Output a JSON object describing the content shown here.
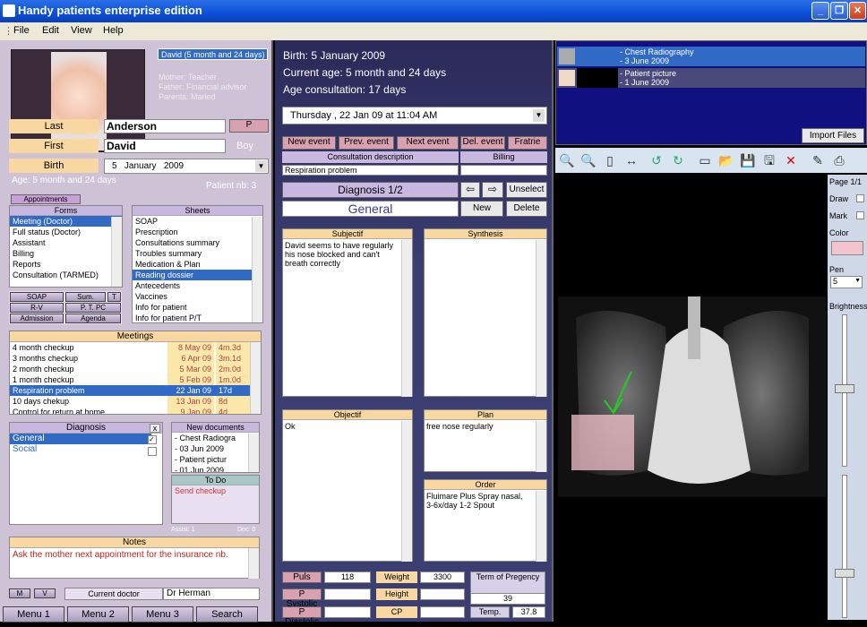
{
  "app": {
    "title": "Handy patients enterprise edition"
  },
  "menu": [
    "File",
    "Edit",
    "View",
    "Help"
  ],
  "patient": {
    "header": "David  (5 month and 24 days)",
    "mother": "Mother: Teacher",
    "father": "Father: Financial advisor",
    "parents": "Parents: Maried",
    "last_label": "Last",
    "last": "Anderson",
    "p_btn": "P",
    "first_label": "First",
    "first": "David",
    "sex": "Boy",
    "birth_label": "Birth",
    "birth_day": "5",
    "birth_month": "January",
    "birth_year": "2009",
    "age": "Age: 5 month and 24 days",
    "patient_nb": "Patient nb: 3"
  },
  "appointments_btn": "Appointments",
  "forms": {
    "title": "Forms",
    "items": [
      "Meeting (Doctor)",
      "Full status (Doctor)",
      "Assistant",
      "Billing",
      "Reports",
      "Consultation (TARMED)"
    ]
  },
  "sheets": {
    "title": "Sheets",
    "items": [
      "SOAP",
      "Prescription",
      "Consultations summary",
      "Troubles summary",
      "Medication & Plan",
      "Reading dossier",
      "Antecedents",
      "Vaccines",
      "Info for patient",
      "Info for patient P/T"
    ]
  },
  "small_btns": {
    "soap": "SOAP",
    "sum": "Sum.",
    "t": "T",
    "rv": "R-V",
    "ptpc": "P. T. PC",
    "admission": "Admission",
    "agenda": "Agenda"
  },
  "meetings": {
    "title": "Meetings",
    "rows": [
      [
        "4 month checkup",
        "8 May 09",
        "4m.3d"
      ],
      [
        "3 months checkup",
        "6 Apr 09",
        "3m.1d"
      ],
      [
        "2 month checkup",
        "5 Mar 09",
        "2m.0d"
      ],
      [
        "1 month checkup",
        "5 Feb 09",
        "1m.0d"
      ],
      [
        "Respiration problem",
        "22 Jan 09",
        "17d"
      ],
      [
        "10 days chekup",
        "13 Jan 09",
        "8d"
      ],
      [
        "Control for return at home",
        "9 Jan 09",
        "4d"
      ]
    ]
  },
  "diagnosis": {
    "title": "Diagnosis",
    "close": "x",
    "items": [
      "General",
      "Social"
    ]
  },
  "new_documents": {
    "title": "New documents",
    "items": [
      "- Chest Radiogra",
      "- 03 Jun 2009",
      "- Patient pictur",
      "- 01 Jun 2009"
    ]
  },
  "todo": {
    "title": "To Do",
    "item": "Send checkup",
    "assist": "Assist: 1",
    "doc": "Doc: 0"
  },
  "notes": {
    "title": "Notes",
    "text": "Ask the mother next appointment for the insurance nb."
  },
  "doctor": {
    "m": "M",
    "v": "V",
    "label": "Current doctor",
    "name": "Dr Herman"
  },
  "bottom_menu": [
    "Menu 1",
    "Menu 2",
    "Menu 3",
    "Search"
  ],
  "consult": {
    "birth": "Birth: 5 January 2009",
    "current_age": "Current age: 5 month and 24 days",
    "age_consult": "Age consultation: 17 days",
    "date": "Thursday ,  22 Jan 09  at   11:04 AM"
  },
  "event_btns": [
    "New event",
    "Prev. event",
    "Next event",
    "Del. event",
    "Fratrie"
  ],
  "consult_desc": {
    "label": "Consultation description",
    "billing": "Billing",
    "value": "Respiration problem"
  },
  "diag": {
    "title": "Diagnosis 1/2",
    "name": "General",
    "unselect": "Unselect",
    "new": "New",
    "delete": "Delete"
  },
  "soap": {
    "subjectif": "Subjectif",
    "subjectif_text": "David seems to have regularly his nose blocked and can't breath correctly",
    "synthesis": "Synthesis",
    "objectif": "Objectif",
    "objectif_text": "Ok",
    "plan": "Plan",
    "plan_text": "free nose regularly",
    "order": "Order",
    "order_text": "Fluimare Plus Spray nasal, 3-6x/day 1-2 Spout"
  },
  "vitals": {
    "puls_label": "Puls",
    "puls": "118",
    "weight_label": "Weight",
    "weight": "3300",
    "term_label": "Term of Pregency",
    "term": "39",
    "psys_label": "P Systolic",
    "height_label": "Height",
    "pdia_label": "P Diastolic",
    "cp_label": "CP",
    "temp_label": "Temp.",
    "temp": "37.8"
  },
  "files": {
    "items": [
      [
        "- Chest Radiography",
        "- 3 June 2009"
      ],
      [
        "- Patient picture",
        "- 1 June 2009"
      ]
    ],
    "import": "Import Files"
  },
  "viewer": {
    "page": "Page 1/1",
    "draw": "Draw",
    "mark": "Mark",
    "color": "Color",
    "pen_label": "Pen",
    "pen": "5",
    "brightness": "Brightness",
    "color_value": "#f4c4cc"
  }
}
